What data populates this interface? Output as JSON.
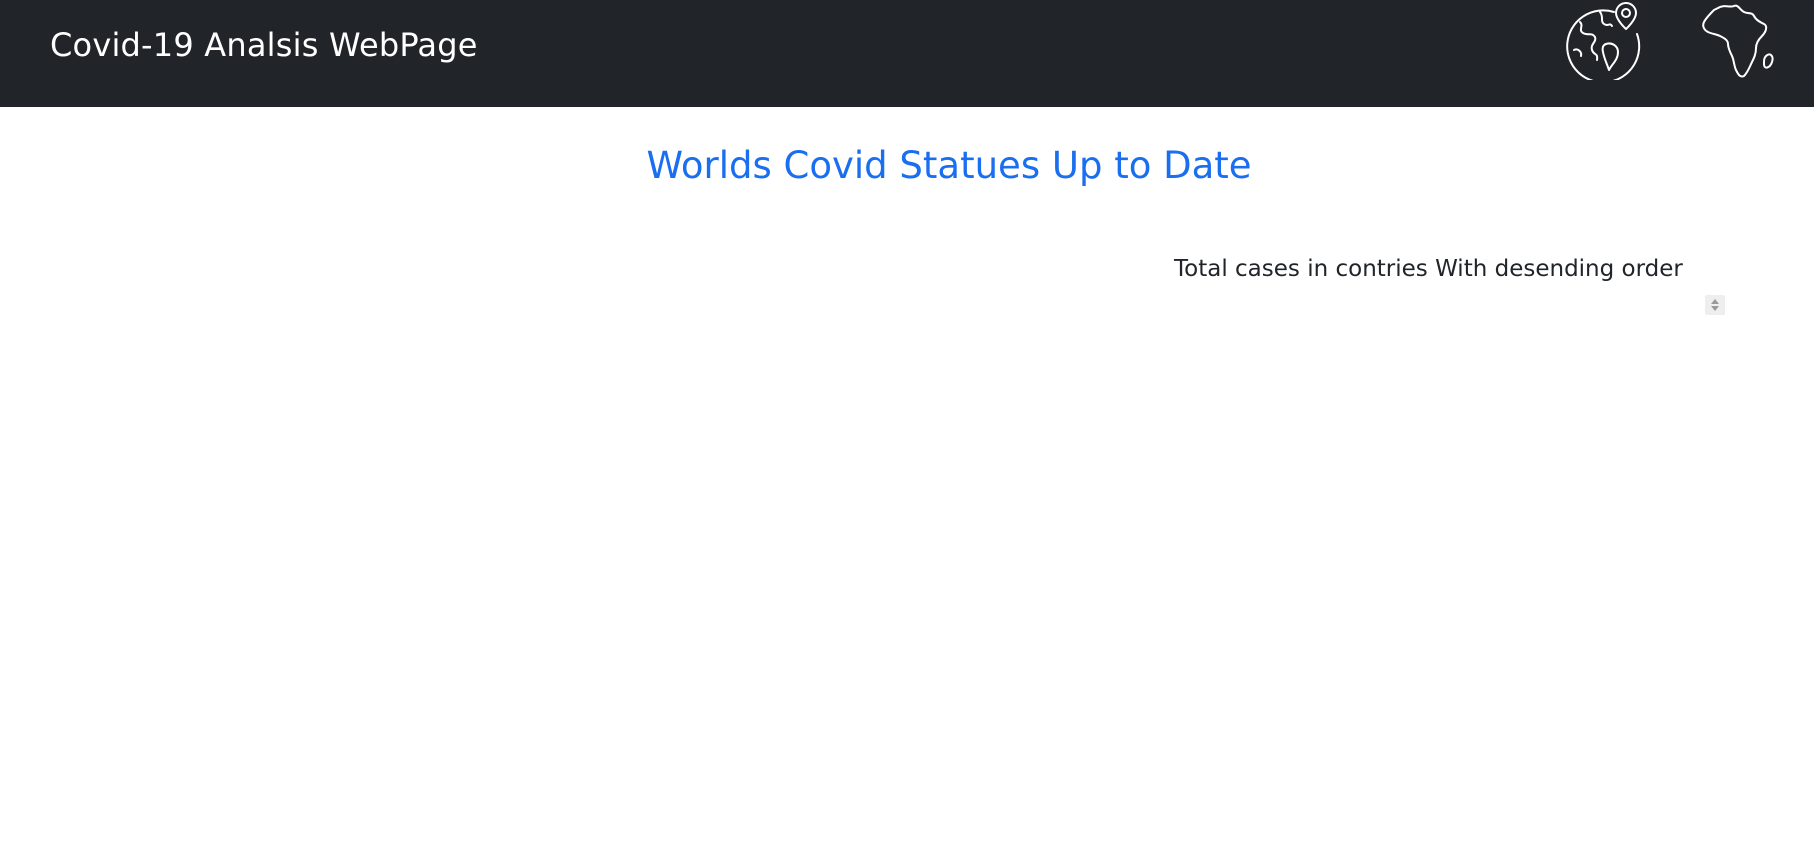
{
  "navbar": {
    "brand": "Covid-19 Analsis WebPage",
    "background": "#212529",
    "icons": [
      {
        "name": "globe-location-icon"
      },
      {
        "name": "africa-map-icon"
      }
    ]
  },
  "main": {
    "title": "Worlds Covid Statues Up to Date",
    "title_color": "#1a6ef0",
    "table_section": {
      "title": "Total cases in contries With desending order",
      "sort_icon": "sort-icon"
    }
  }
}
